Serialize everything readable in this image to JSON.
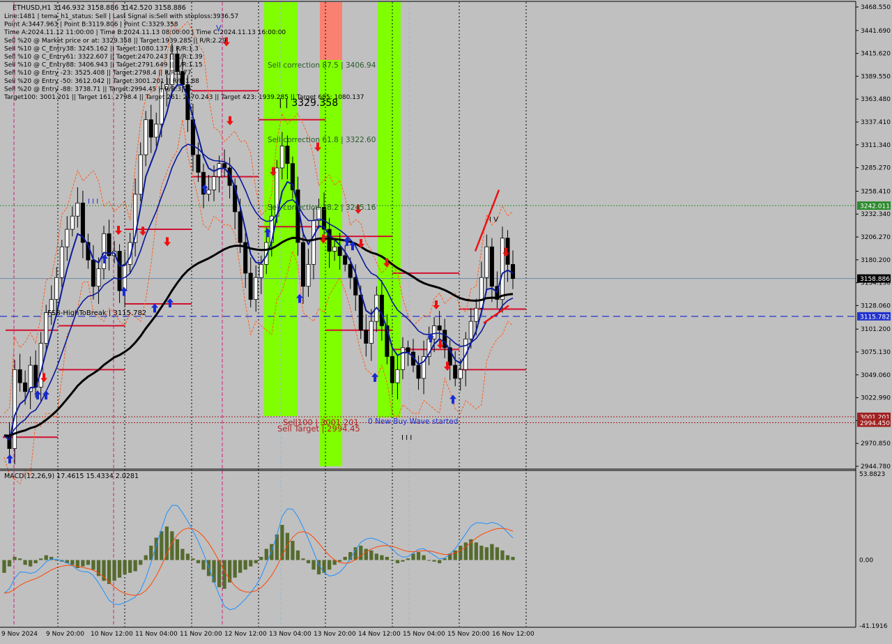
{
  "header": {
    "symbol_line": "ETHUSD,H1  3146.932 3158.886 3142.520 3158.886",
    "info_lines": [
      "Line:1481 | tema_h1_status: Sell | Last Signal is:Sell with stoploss:3936.57",
      "Point A:3447.963 | Point B:3119.806 | Point C:3329.358",
      "Time A:2024.11.12 11:00:00 | Time B:2024.11.13 08:00:00 | Time C:2024.11.13 16:00:00",
      "Sell %20 @ Market price or at: 3329.358 || Target:1939.285 || R/R:2.29",
      "Sell %10 @ C_Entry38: 3245.162 || Target:1080.137 || R/R:1.3",
      "Sell %10 @ C_Entry61: 3322.607 || Target:2470.243 || R/R:1.39",
      "Sell %10 @ C_Entry88: 3406.943 || Target:2791.649 || R/R:1.15",
      "Sell %10 @ Entry -23: 3525.408 || Target:2798.4 || R/R:1.77",
      "Sell %20 @ Entry -50: 3612.042 || Target:3001.201 || R/R:1.88",
      "Sell %20 @ Entry -88: 3738.71 || Target:2994.45 || R/R:3.76",
      "Target100: 3001.201 || Target 161: 2798.4 || Target 261: 2470.243 || Target 423: 1939.285 || Target 685: 1080.137"
    ]
  },
  "annotations": {
    "sell_correction_875": "Sell correction 87.5 | 3406.94",
    "sell_correction_618": "Sell correction 61.8 | 3322.60",
    "sell_correction_382": "Sell correction 38.2 | 3245.16",
    "price_c_label": "| | 3329.358",
    "fsb_label": "FSB-HighToBreak | 3115.782",
    "sell100_label": "Sell100 | 3001.201",
    "sell_target_label": "Sell Target | 2994.45",
    "new_buy_wave": "0 New Buy Wave started",
    "marks_iii": "I I I",
    "marks_v": "V",
    "marks_iv": "I V"
  },
  "macd": {
    "label": "MACD(12,26,9) 17.4615 15.4334 2.0281"
  },
  "price_axis": {
    "ticks": [
      "3468.550",
      "3441.690",
      "3415.620",
      "3389.550",
      "3363.480",
      "3337.410",
      "3311.340",
      "3285.270",
      "3258.410",
      "3232.340",
      "3206.270",
      "3180.200",
      "3154.130",
      "3128.060",
      "3101.200",
      "3075.130",
      "3049.060",
      "3022.990",
      "2996.920",
      "2970.850",
      "2944.780"
    ],
    "badges": [
      {
        "text": "3242.011",
        "price": 3242.011,
        "color": "#2e8b2e"
      },
      {
        "text": "3158.886",
        "price": 3158.886,
        "color": "#000000"
      },
      {
        "text": "3115.782",
        "price": 3115.782,
        "color": "#2233cc"
      },
      {
        "text": "3001.201",
        "price": 3001.201,
        "color": "#a02020"
      },
      {
        "text": "2994.450",
        "price": 2994.45,
        "color": "#a02020"
      }
    ]
  },
  "macd_axis": {
    "ticks": [
      "53.8823",
      "0.00",
      "-41.1916"
    ]
  },
  "time_axis": {
    "labels": [
      "9 Nov 2024",
      "9 Nov 20:00",
      "10 Nov 12:00",
      "11 Nov 04:00",
      "11 Nov 20:00",
      "12 Nov 12:00",
      "13 Nov 04:00",
      "13 Nov 20:00",
      "14 Nov 12:00",
      "15 Nov 04:00",
      "15 Nov 20:00",
      "16 Nov 12:00"
    ]
  },
  "chart_data": {
    "type": "candlestick",
    "instrument": "ETHUSD",
    "timeframe": "H1",
    "ylim": [
      2940,
      3475
    ],
    "last_close": 3158.886,
    "key_levels": {
      "point_a": 3447.963,
      "point_b": 3119.806,
      "point_c": 3329.358,
      "fsb_high_to_break": 3115.782,
      "sell100": 3001.201,
      "sell_target": 2994.45,
      "green_dotted": 3242.011
    },
    "close_path": [
      2980,
      2965,
      3055,
      3040,
      3030,
      3060,
      3035,
      3085,
      3120,
      3135,
      3160,
      3195,
      3215,
      3230,
      3245,
      3200,
      3180,
      3150,
      3170,
      3210,
      3185,
      3190,
      3145,
      3175,
      3200,
      3255,
      3300,
      3340,
      3320,
      3335,
      3375,
      3380,
      3415,
      3395,
      3380,
      3340,
      3300,
      3280,
      3255,
      3260,
      3275,
      3290,
      3285,
      3265,
      3235,
      3200,
      3165,
      3135,
      3160,
      3175,
      3200,
      3230,
      3285,
      3310,
      3290,
      3260,
      3200,
      3150,
      3175,
      3225,
      3240,
      3215,
      3190,
      3195,
      3185,
      3175,
      3160,
      3140,
      3100,
      3085,
      3110,
      3140,
      3105,
      3070,
      3040,
      3055,
      3080,
      3075,
      3060,
      3045,
      3070,
      3090,
      3105,
      3100,
      3080,
      3060,
      3045,
      3055,
      3090,
      3110,
      3125,
      3160,
      3195,
      3150,
      3135,
      3205,
      3175,
      3158.886
    ],
    "macd_values": [
      -8,
      -4,
      2,
      1,
      -3,
      -4,
      -2,
      1,
      3,
      2,
      0,
      -1,
      -2,
      -3,
      -5,
      -4,
      -3,
      -6,
      -10,
      -13,
      -15,
      -13,
      -11,
      -9,
      -8,
      -7,
      -3,
      3,
      9,
      14,
      18,
      21,
      18,
      13,
      7,
      4,
      1,
      -2,
      -6,
      -10,
      -14,
      -17,
      -18,
      -14,
      -11,
      -8,
      -6,
      -4,
      -2,
      2,
      7,
      10,
      16,
      22,
      17,
      12,
      6,
      1,
      -2,
      -6,
      -9,
      -8,
      -6,
      -3,
      -1,
      2,
      5,
      8,
      9,
      7,
      6,
      4,
      3,
      2,
      0,
      -2,
      -1,
      1,
      4,
      5,
      3,
      0,
      -1,
      -2,
      1,
      4,
      6,
      9,
      11,
      13,
      11,
      9,
      8,
      10,
      8,
      6,
      3,
      2
    ]
  }
}
